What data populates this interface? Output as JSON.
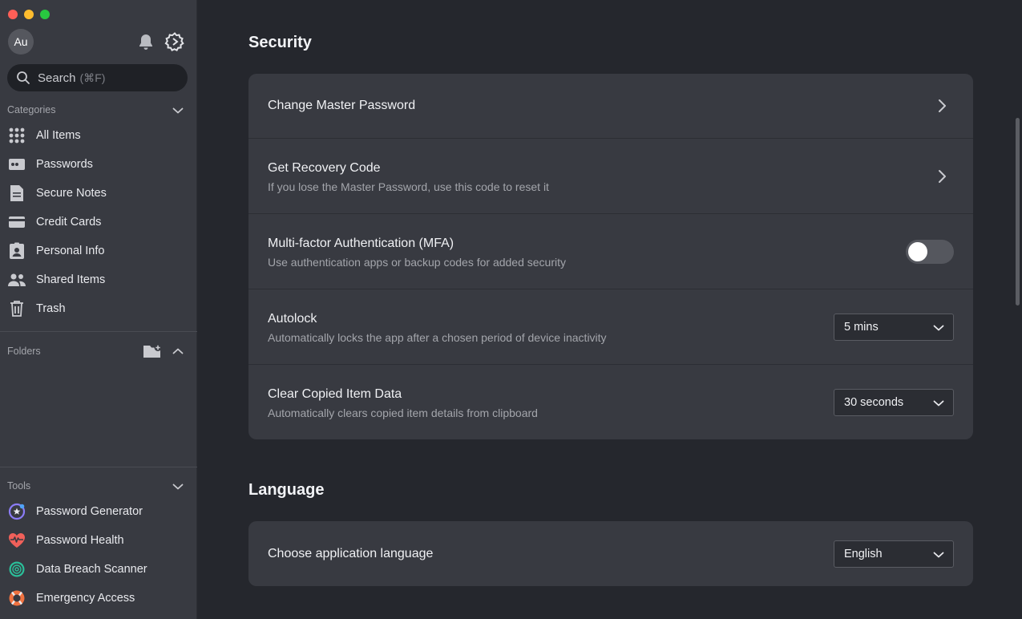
{
  "window": {
    "traffic_colors": [
      "#fe5f57",
      "#febc2e",
      "#28c840"
    ]
  },
  "sidebar": {
    "avatar_initials": "Au",
    "search": {
      "placeholder": "Search",
      "shortcut": "(⌘F)"
    },
    "categories": {
      "label": "Categories",
      "items": [
        {
          "label": "All Items",
          "icon": "grid-icon"
        },
        {
          "label": "Passwords",
          "icon": "password-icon"
        },
        {
          "label": "Secure Notes",
          "icon": "note-icon"
        },
        {
          "label": "Credit Cards",
          "icon": "credit-card-icon"
        },
        {
          "label": "Personal Info",
          "icon": "id-badge-icon"
        },
        {
          "label": "Shared Items",
          "icon": "people-icon"
        },
        {
          "label": "Trash",
          "icon": "trash-icon"
        }
      ]
    },
    "folders": {
      "label": "Folders"
    },
    "tools": {
      "label": "Tools",
      "items": [
        {
          "label": "Password Generator",
          "icon": "password-generator-icon",
          "color": "#8b7cf6"
        },
        {
          "label": "Password Health",
          "icon": "heart-pulse-icon",
          "color": "#f0605a"
        },
        {
          "label": "Data Breach Scanner",
          "icon": "radar-icon",
          "color": "#2bbf9a"
        },
        {
          "label": "Emergency Access",
          "icon": "lifebuoy-icon",
          "color": "#f07240"
        }
      ]
    }
  },
  "main": {
    "security": {
      "title": "Security",
      "change_master_password": {
        "title": "Change Master Password"
      },
      "recovery_code": {
        "title": "Get Recovery Code",
        "subtitle": "If you lose the Master Password, use this code to reset it"
      },
      "mfa": {
        "title": "Multi-factor Authentication (MFA)",
        "subtitle": "Use authentication apps or backup codes for added security",
        "enabled": false
      },
      "autolock": {
        "title": "Autolock",
        "subtitle": "Automatically locks the app after a chosen period of device inactivity",
        "value": "5 mins"
      },
      "clear_copied": {
        "title": "Clear Copied Item Data",
        "subtitle": "Automatically clears copied item details from clipboard",
        "value": "30 seconds"
      }
    },
    "language": {
      "title": "Language",
      "choose": {
        "title": "Choose application language",
        "value": "English"
      }
    }
  }
}
